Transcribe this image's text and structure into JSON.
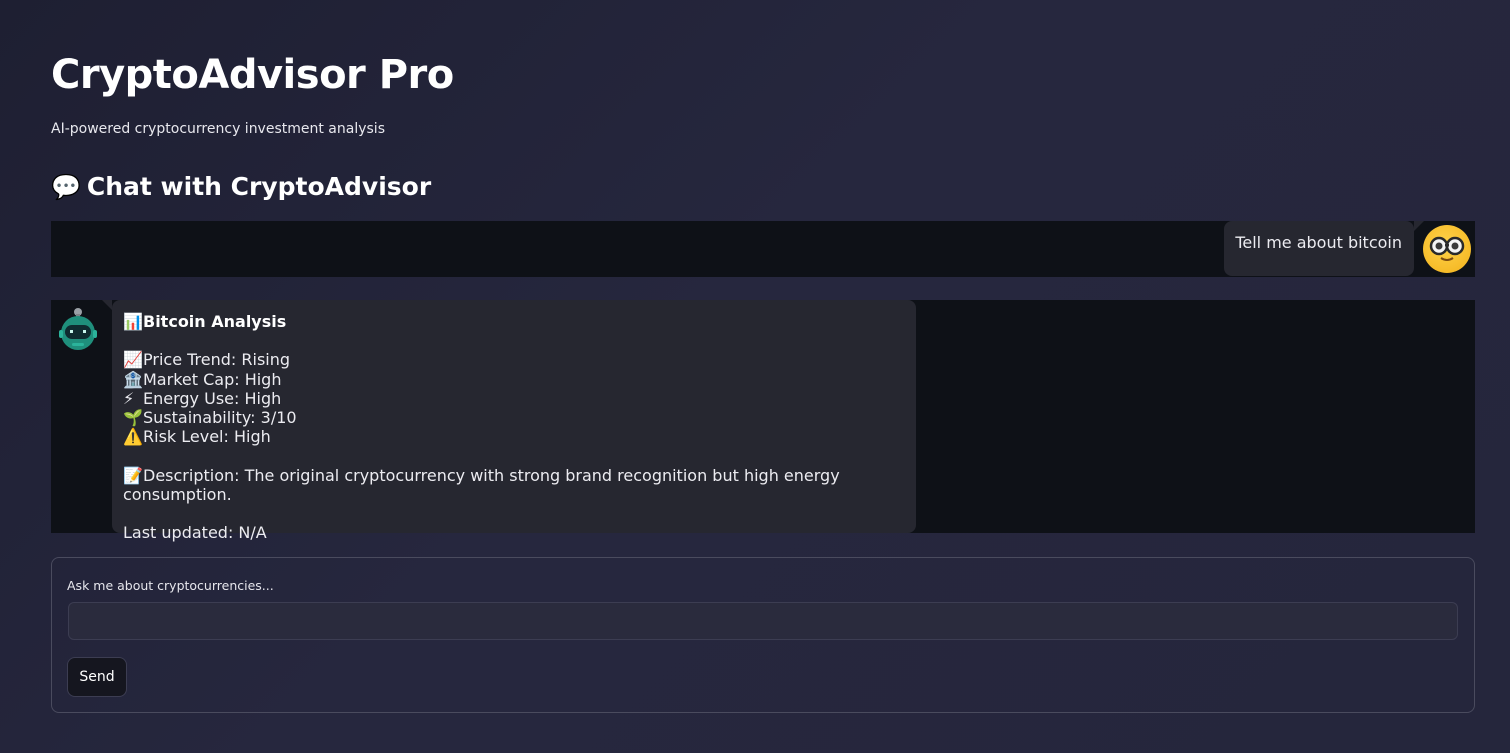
{
  "header": {
    "title": "CryptoAdvisor Pro",
    "subtitle": "AI-powered cryptocurrency investment analysis"
  },
  "chat_section": {
    "icon": "💬",
    "heading": "Chat with CryptoAdvisor"
  },
  "messages": [
    {
      "role": "user",
      "avatar": "nerd-face-icon",
      "text": "Tell me about bitcoin"
    },
    {
      "role": "assistant",
      "avatar": "robot-icon",
      "title_icon": "📊",
      "title": "Bitcoin Analysis",
      "stats": [
        {
          "icon": "📈",
          "text": "Price Trend: Rising"
        },
        {
          "icon": "🏦",
          "text": "Market Cap: High"
        },
        {
          "icon": "⚡",
          "text": "Energy Use: High"
        },
        {
          "icon": "🌱",
          "text": "Sustainability: 3/10"
        },
        {
          "icon": "⚠️",
          "text": "Risk Level: High"
        }
      ],
      "description_icon": "📝",
      "description": "Description: The original cryptocurrency with strong brand recognition but high energy consumption.",
      "last_updated": "Last updated: N/A"
    }
  ],
  "input_form": {
    "label": "Ask me about cryptocurrencies...",
    "value": "",
    "placeholder": "",
    "send_label": "Send"
  },
  "colors": {
    "chat_row_bg": "#0e1117",
    "bubble_bg": "#262730",
    "page_bg": "#23243a"
  }
}
